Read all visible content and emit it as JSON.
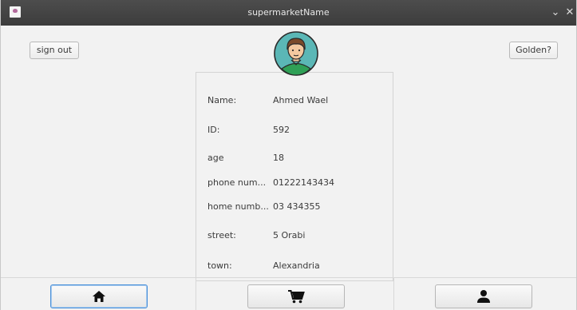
{
  "window": {
    "title": "supermarketName"
  },
  "header": {
    "sign_out_label": "sign out",
    "golden_label": "Golden?"
  },
  "profile": {
    "fields": [
      {
        "label": "Name:",
        "value": "Ahmed Wael"
      },
      {
        "label": "ID:",
        "value": "592"
      },
      {
        "label": "age",
        "value": "18"
      },
      {
        "label": "phone num...",
        "value": "01222143434"
      },
      {
        "label": "home numb...",
        "value": "03 434355"
      },
      {
        "label": "street:",
        "value": "5 Orabi"
      },
      {
        "label": "town:",
        "value": "Alexandria"
      }
    ]
  },
  "icons": {
    "window_controls": [
      "chevron-down-icon",
      "close-icon"
    ],
    "nav": [
      "home-icon",
      "cart-icon",
      "user-icon"
    ]
  },
  "colors": {
    "titlebar": "#3f3f3f",
    "background": "#f2f2f2",
    "avatar_bg": "#5bb7b6",
    "active_nav_border": "#4a90d9"
  }
}
